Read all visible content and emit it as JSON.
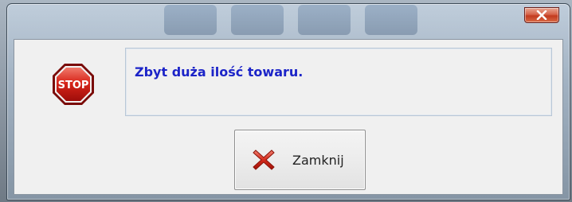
{
  "dialog": {
    "message": "Zbyt duża ilość towaru.",
    "message_color": "#1c24c8",
    "icon": "stop-sign-icon",
    "icon_text": "STOP",
    "close_button_label": "Zamknij",
    "close_button_icon": "red-x-icon",
    "titlebar_close_icon": "close-icon"
  }
}
